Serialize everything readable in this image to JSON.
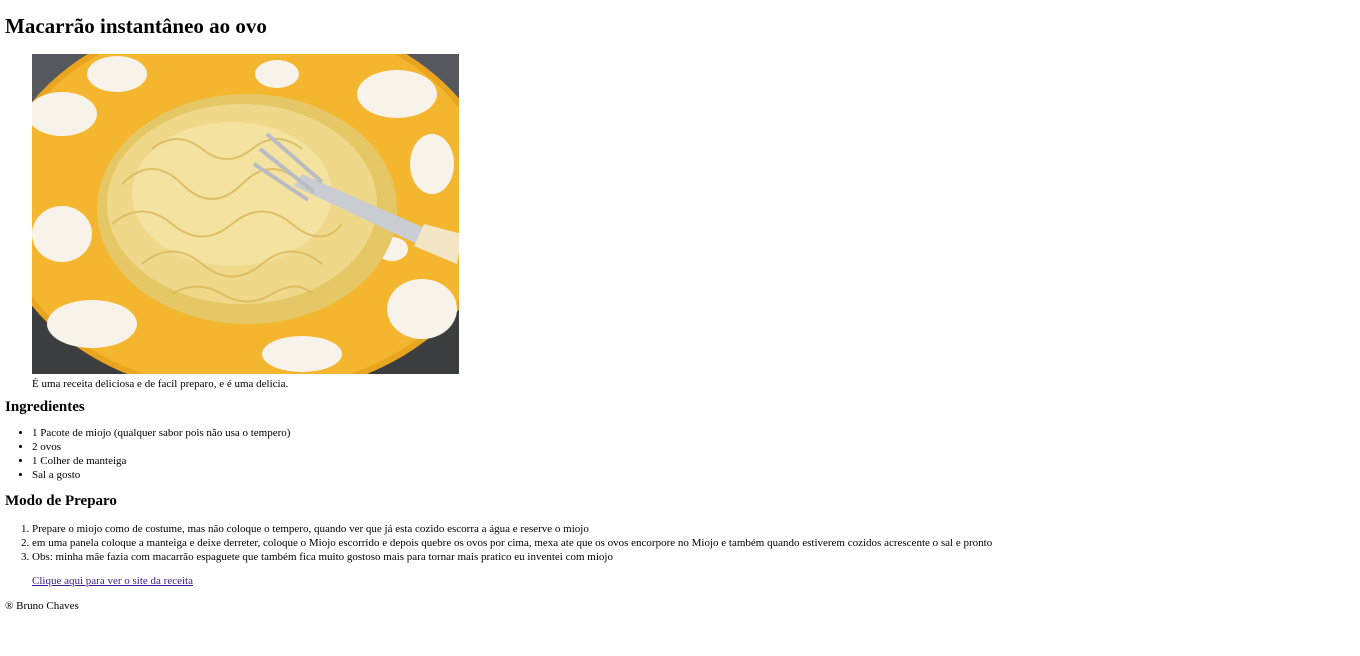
{
  "recipe": {
    "title": "Macarrão instantâneo ao ovo",
    "image_alt": "Prato de macarrão instantâneo com garfo",
    "caption": "É uma receita deliciosa e de facil preparo, e é uma delicia.",
    "ingredients_heading": "Ingredientes",
    "ingredients": [
      "1 Pacote de miojo (qualquer sabor pois não usa o tempero)",
      "2 ovos",
      "1 Colher de manteiga",
      "Sal a gosto"
    ],
    "preparo_heading": "Modo de Preparo",
    "steps": [
      "Prepare o miojo como de costume, mas não coloque o tempero, quando ver que já esta cozido escorra a água e reserve o miojo",
      "em uma panela coloque a manteiga e deixe derreter, coloque o Miojo escorrido e depois quebre os ovos por cima, mexa ate que os ovos encorpore no Miojo e também quando estiverem cozidos acrescente o sal e pronto",
      "Obs: minha mãe fazia com macarrão espaguete que também fica muito gostoso mais para tornar mais pratico eu inventei com miojo"
    ],
    "link_text": "Clique aqui para ver o site da receita"
  },
  "footer": {
    "copyright": "® Bruno Chaves"
  },
  "colors": {
    "plate_yellow": "#f2b830",
    "noodle": "#ecd78a",
    "link": "#3b1a8a"
  }
}
